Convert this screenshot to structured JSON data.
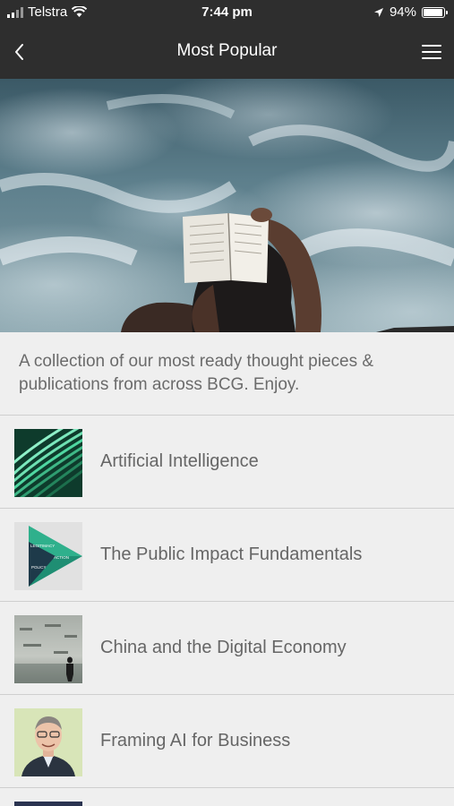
{
  "status": {
    "carrier": "Telstra",
    "time": "7:44 pm",
    "battery": "94%",
    "battery_level": 0.94
  },
  "nav": {
    "title": "Most Popular",
    "back_icon": "chevron-left-icon",
    "menu_icon": "hamburger-menu-icon"
  },
  "hero": {
    "image": "person reading book above ocean waves"
  },
  "description": "A collection of our most ready thought pieces & publications from across BCG. Enjoy.",
  "items": [
    {
      "label": "Artificial Intelligence"
    },
    {
      "label": "The Public Impact Fundamentals",
      "thumb_text": [
        "LEGITIMACY",
        "ACTION",
        "POLICY"
      ]
    },
    {
      "label": "China and the Digital Economy"
    },
    {
      "label": "Framing AI for Business"
    }
  ]
}
